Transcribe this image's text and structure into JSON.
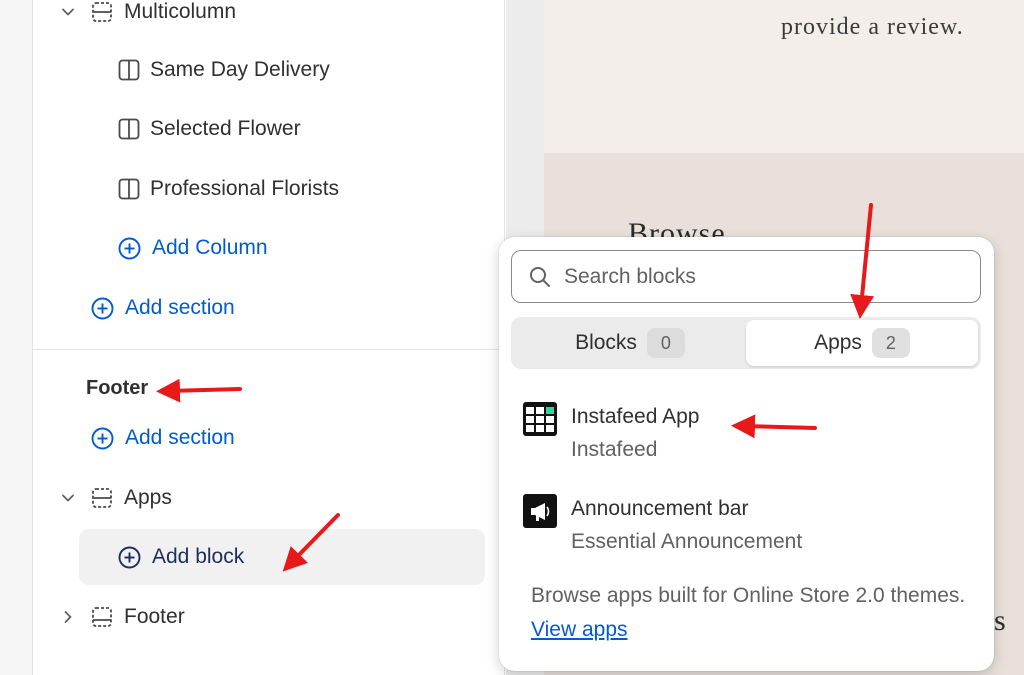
{
  "sidebar": {
    "multicolumn": {
      "label": "Multicolumn",
      "columns": [
        {
          "label": "Same Day Delivery"
        },
        {
          "label": "Selected Flower"
        },
        {
          "label": "Professional Florists"
        }
      ],
      "add_column_label": "Add Column"
    },
    "add_section_label": "Add section",
    "footer_group": {
      "heading": "Footer",
      "add_section_label": "Add section",
      "apps_label": "Apps",
      "add_block_label": "Add block",
      "footer_label": "Footer"
    }
  },
  "preview": {
    "review_text": "provide a review.",
    "browse_text": "Browse",
    "trailing_char": "s"
  },
  "popover": {
    "search_placeholder": "Search blocks",
    "tabs": [
      {
        "label": "Blocks",
        "count": "0",
        "active": false
      },
      {
        "label": "Apps",
        "count": "2",
        "active": true
      }
    ],
    "apps": [
      {
        "name": "Instafeed App",
        "developer": "Instafeed",
        "icon": "instafeed-grid-icon"
      },
      {
        "name": "Announcement bar",
        "developer": "Essential Announcement",
        "icon": "megaphone-icon"
      }
    ],
    "footer_text": "Browse apps built for Online Store 2.0 themes.",
    "footer_link": "View apps"
  },
  "colors": {
    "link_blue": "#005bd3",
    "annotation_red": "#e8191a",
    "preview_bg": "#e9e0db"
  }
}
